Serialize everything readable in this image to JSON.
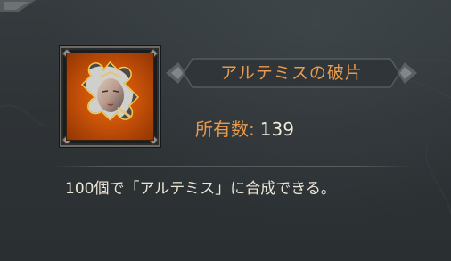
{
  "item": {
    "name": "アルテミスの破片",
    "count_label": "所有数:",
    "count_value": "139",
    "description": "100個で「アルテミス」に合成できる。",
    "icon": "puzzle-piece-portrait-icon",
    "frame_color": "#d8862a"
  },
  "colors": {
    "accent_orange": "#e89a4d",
    "text_light": "#ece6d6",
    "panel_bg": "#2e3336"
  }
}
